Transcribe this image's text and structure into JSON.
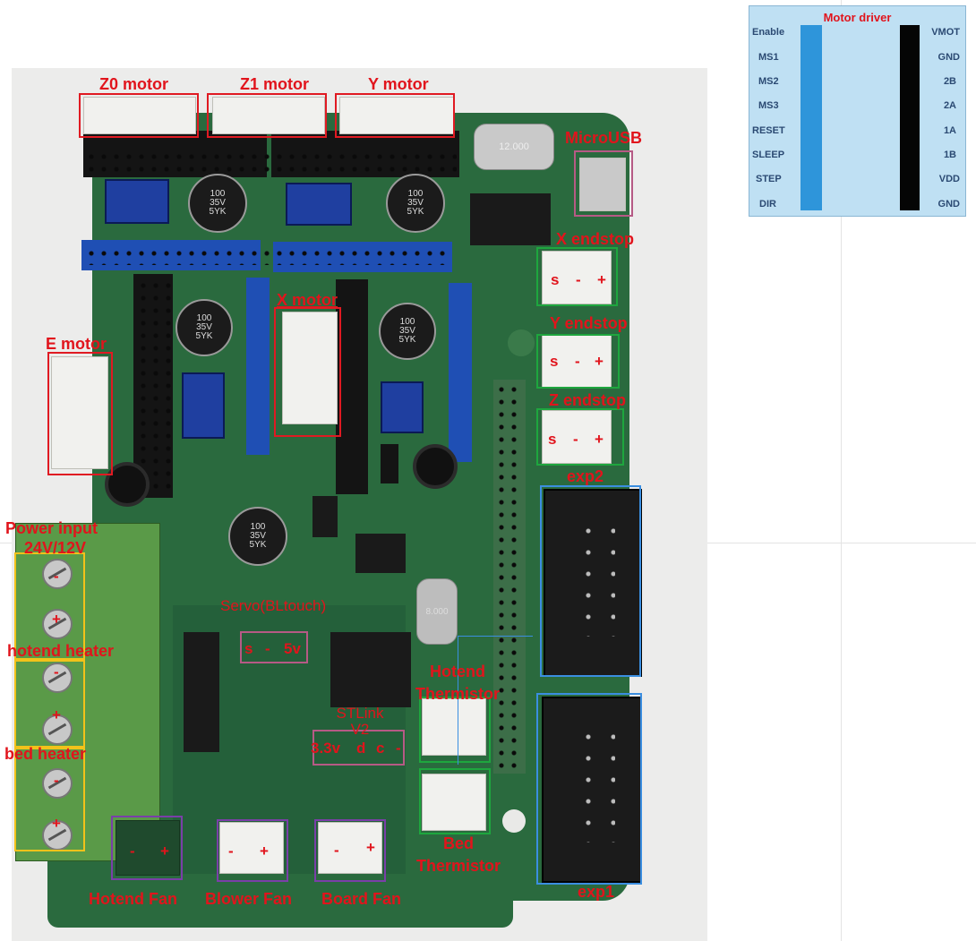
{
  "diagram": {
    "labels": {
      "z0_motor": "Z0 motor",
      "z1_motor": "Z1 motor",
      "y_motor": "Y motor",
      "microusb": "MicroUSB",
      "x_endstop": "X endstop",
      "y_endstop": "Y endstop",
      "z_endstop": "Z endstop",
      "exp2": "exp2",
      "exp1": "exp1",
      "x_motor": "X motor",
      "e_motor": "E motor",
      "power_input": "Power input",
      "power_voltage": "24V/12V",
      "hotend_heater": "hotend heater",
      "bed_heater": "bed heater",
      "servo": "Servo(BLtouch)",
      "stlink": "STLink V2",
      "hotend_thermistor": "Hotend Thermistor",
      "bed_thermistor": "Bed Thermistor",
      "hotend_fan": "Hotend Fan",
      "blower_fan": "Blower Fan",
      "board_fan": "Board Fan"
    },
    "pin_labels": {
      "endstop": [
        "s",
        "-",
        "+"
      ],
      "servo": [
        "s",
        "-",
        "5v"
      ],
      "stlink": [
        "3.3v",
        "d",
        "c",
        "-"
      ],
      "power_terminal": [
        "-",
        "+"
      ],
      "fan": [
        "-",
        "+"
      ]
    },
    "board_silkscreen": {
      "capacitor": "100\n35V\n5YK",
      "crystal_usb": "12.000",
      "crystal_mcu": "8.000"
    }
  },
  "legend": {
    "title": "Motor driver",
    "left_pins": [
      "Enable",
      "MS1",
      "MS2",
      "MS3",
      "RESET",
      "SLEEP",
      "STEP",
      "DIR"
    ],
    "right_pins": [
      "VMOT",
      "GND",
      "2B",
      "2A",
      "1A",
      "1B",
      "VDD",
      "GND"
    ],
    "colors": {
      "left_bar": "#2e95da",
      "right_bar": "#050505",
      "background": "#bfe0f3"
    }
  },
  "colors": {
    "label_red": "#e1141c",
    "motor_box": "#e01a22",
    "endstop_box": "#1ea63e",
    "exp_box": "#3b8ee0",
    "power_box": "#f2c21a",
    "fan_box": "#7a3fa8",
    "usb_box": "#b65a85",
    "pcb": "#2a6a3e"
  }
}
